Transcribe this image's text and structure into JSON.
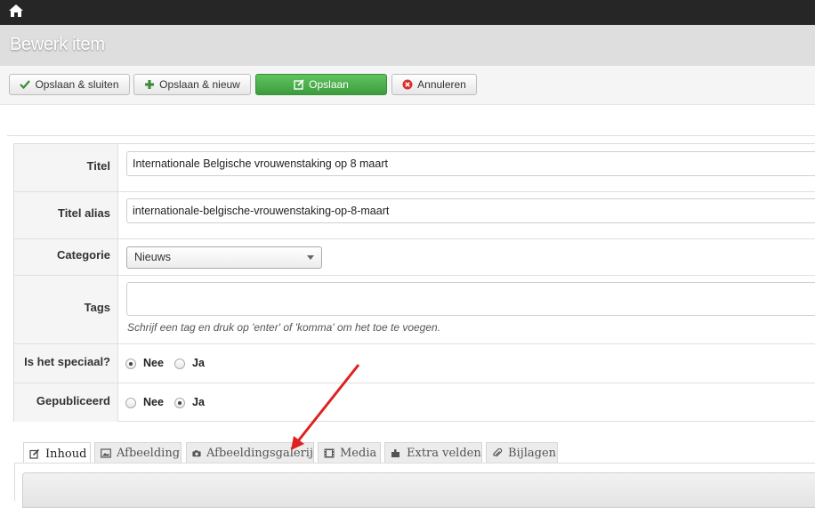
{
  "header": {
    "title": "Bewerk item"
  },
  "toolbar": {
    "save_close": "Opslaan & sluiten",
    "save_new": "Opslaan & nieuw",
    "save": "Opslaan",
    "cancel": "Annuleren"
  },
  "form": {
    "title_label": "Titel",
    "title_value": "Internationale Belgische vrouwenstaking op 8 maart",
    "alias_label": "Titel alias",
    "alias_value": "internationale-belgische-vrouwenstaking-op-8-maart",
    "category_label": "Categorie",
    "category_value": "Nieuws",
    "tags_label": "Tags",
    "tags_hint": "Schrijf een tag en druk op 'enter' of 'komma' om het toe te voegen.",
    "special_label": "Is het speciaal?",
    "special_options": [
      "Nee",
      "Ja"
    ],
    "special_selected": "Nee",
    "published_label": "Gepubliceerd",
    "published_options": [
      "Nee",
      "Ja"
    ],
    "published_selected": "Ja"
  },
  "tabs": [
    {
      "label": "Inhoud",
      "icon": "edit-icon",
      "active": true
    },
    {
      "label": "Afbeelding",
      "icon": "image-icon",
      "active": false
    },
    {
      "label": "Afbeeldingsgalerij",
      "icon": "camera-icon",
      "active": false
    },
    {
      "label": "Media",
      "icon": "film-icon",
      "active": false
    },
    {
      "label": "Extra velden",
      "icon": "puzzle-icon",
      "active": false
    },
    {
      "label": "Bijlagen",
      "icon": "paperclip-icon",
      "active": false
    }
  ],
  "colors": {
    "topbar": "#262626",
    "save_green": "#4cae4c",
    "annotation_arrow": "#e02020"
  }
}
